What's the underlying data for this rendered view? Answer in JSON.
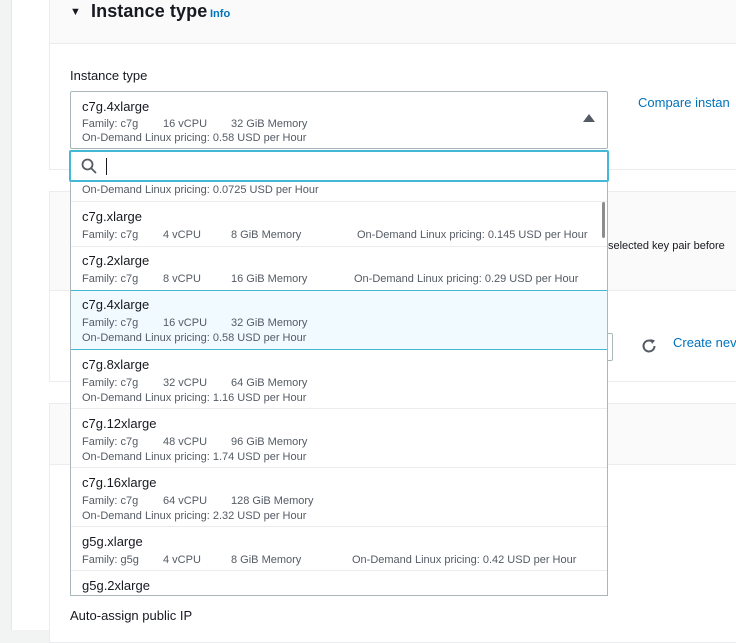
{
  "instance_type_section": {
    "title": "Instance type",
    "info_label": "Info",
    "field_label": "Instance type",
    "compare_link": "Compare instan",
    "selected": {
      "name": "c7g.4xlarge",
      "family": "Family: c7g",
      "vcpu": "16 vCPU",
      "memory": "32 GiB Memory",
      "pricing": "On-Demand Linux pricing: 0.58 USD per Hour"
    },
    "search": {
      "value": "",
      "placeholder": ""
    }
  },
  "dropdown": {
    "partial_top_pricing": "On-Demand Linux pricing: 0.0725 USD per Hour",
    "options": [
      {
        "name": "c7g.xlarge",
        "family": "Family: c7g",
        "vcpu": "4 vCPU",
        "memory": "8 GiB Memory",
        "pricing": "On-Demand Linux pricing: 0.145 USD per Hour",
        "selected": false
      },
      {
        "name": "c7g.2xlarge",
        "family": "Family: c7g",
        "vcpu": "8 vCPU",
        "memory": "16 GiB Memory",
        "pricing": "On-Demand Linux pricing: 0.29 USD per Hour",
        "selected": false
      },
      {
        "name": "c7g.4xlarge",
        "family": "Family: c7g",
        "vcpu": "16 vCPU",
        "memory": "32 GiB Memory",
        "pricing": "On-Demand Linux pricing: 0.58 USD per Hour",
        "selected": true
      },
      {
        "name": "c7g.8xlarge",
        "family": "Family: c7g",
        "vcpu": "32 vCPU",
        "memory": "64 GiB Memory",
        "pricing": "On-Demand Linux pricing: 1.16 USD per Hour",
        "selected": false
      },
      {
        "name": "c7g.12xlarge",
        "family": "Family: c7g",
        "vcpu": "48 vCPU",
        "memory": "96 GiB Memory",
        "pricing": "On-Demand Linux pricing: 1.74 USD per Hour",
        "selected": false
      },
      {
        "name": "c7g.16xlarge",
        "family": "Family: c7g",
        "vcpu": "64 vCPU",
        "memory": "128 GiB Memory",
        "pricing": "On-Demand Linux pricing: 2.32 USD per Hour",
        "selected": false
      },
      {
        "name": "g5g.xlarge",
        "family": "Family: g5g",
        "vcpu": "4 vCPU",
        "memory": "8 GiB Memory",
        "pricing": "On-Demand Linux pricing: 0.42 USD per Hour",
        "selected": false
      },
      {
        "name": "g5g.2xlarge",
        "family": "",
        "vcpu": "",
        "memory": "",
        "pricing": "",
        "selected": false
      }
    ]
  },
  "key_pair_section": {
    "partial_text": "selected key pair before",
    "create_link": "Create nev"
  },
  "network_section": {
    "auto_assign_label": "Auto-assign public IP"
  },
  "colors": {
    "link": "#0073bb",
    "focus_border": "#44b9d6",
    "selected_bg": "#f1faff",
    "muted_text": "#545b64"
  }
}
